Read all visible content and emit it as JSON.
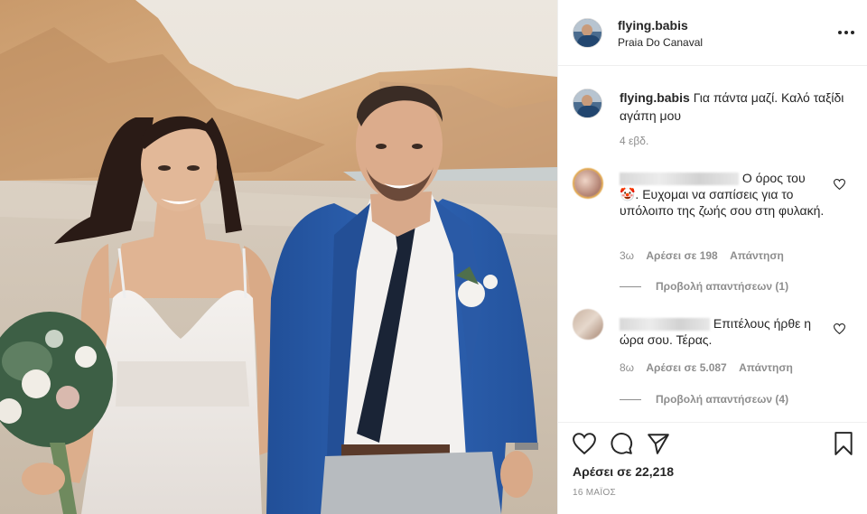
{
  "post": {
    "username": "flying.babis",
    "location": "Praia Do Canaval",
    "more_icon": "more-horizontal-icon"
  },
  "caption": {
    "username": "flying.babis",
    "text": "Για πάντα μαζί. Καλό ταξίδι αγάπη μου",
    "time": "4 εβδ."
  },
  "comments": [
    {
      "text": "Ο όρος του 🤡. Ευχομαι να σαπίσεις για το υπόλοιπο της ζωής σου στη φυλακή.",
      "time": "3ω",
      "likes": "Αρέσει σε 198",
      "reply": "Απάντηση",
      "view_replies": "Προβολή απαντήσεων (1)"
    },
    {
      "text": "Επιτέλους ήρθε η ώρα σου. Τέρας.",
      "time": "8ω",
      "likes": "Αρέσει σε 5.087",
      "reply": "Απάντηση",
      "view_replies": "Προβολή απαντήσεων (4)"
    }
  ],
  "actions": {
    "likes": "Αρέσει σε 22,218",
    "date": "16 ΜΑΪΟΣ",
    "icons": [
      "heart-icon",
      "comment-icon",
      "share-icon",
      "bookmark-icon"
    ]
  },
  "colors": {
    "text": "#262626",
    "muted": "#8e8e8e",
    "border": "#efefef",
    "jacket": "#2b5cab"
  }
}
